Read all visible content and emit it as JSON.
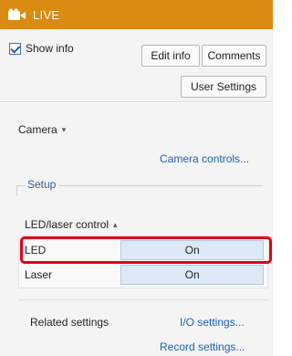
{
  "titlebar": {
    "title": "LIVE",
    "icon": "video-camera-icon"
  },
  "info": {
    "show_info_label": "Show info",
    "show_info_checked": true,
    "edit_info_label": "Edit info",
    "comments_label": "Comments",
    "user_settings_label": "User Settings"
  },
  "camera": {
    "section_label": "Camera",
    "collapse_icon": "caret-down-icon",
    "controls_link": "Camera controls..."
  },
  "setup": {
    "group_label": "Setup"
  },
  "led_laser": {
    "section_label": "LED/laser control",
    "collapse_icon": "caret-up-icon",
    "rows": [
      {
        "label": "LED",
        "value": "On"
      },
      {
        "label": "Laser",
        "value": "On"
      }
    ]
  },
  "related": {
    "label": "Related settings",
    "io_link": "I/O settings...",
    "record_link": "Record settings..."
  },
  "colors": {
    "titlebar_bg": "#d98b12",
    "link": "#1a5fb4",
    "highlight": "#e0001b",
    "toggle_bg": "#dde9f6"
  }
}
